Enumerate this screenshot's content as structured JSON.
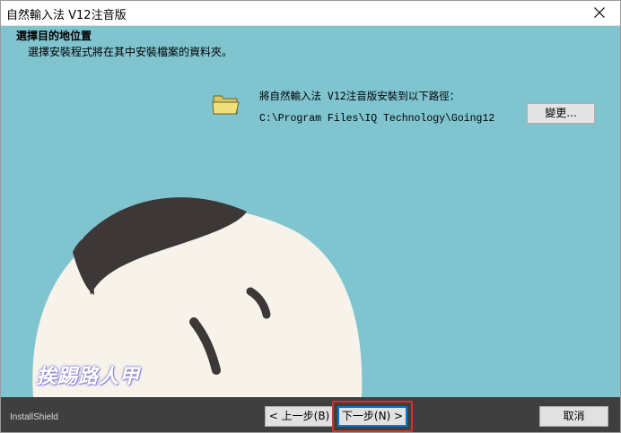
{
  "window": {
    "title": "自然輸入法 V12注音版"
  },
  "header": {
    "heading": "選擇目的地位置",
    "subheading": "選擇安裝程式將在其中安裝檔案的資料夾。"
  },
  "destination": {
    "label": "將自然輸入法 V12注音版安裝到以下路徑：",
    "path": "C:\\Program Files\\IQ Technology\\Going12",
    "change_button": "變更..."
  },
  "watermark": {
    "text": "挨踢路人甲"
  },
  "footer": {
    "brand": "InstallShield",
    "back_button": "< 上一步(B)",
    "next_button": "下一步(N) >",
    "cancel_button": "取消"
  },
  "colors": {
    "background": "#7fc4cf",
    "face": "#f7f3ea",
    "hair": "#3d3738",
    "footer": "#3f3f3f",
    "highlight": "#d92d2d",
    "folder": "#efe07a"
  },
  "icons": [
    "close-icon",
    "folder-icon"
  ]
}
